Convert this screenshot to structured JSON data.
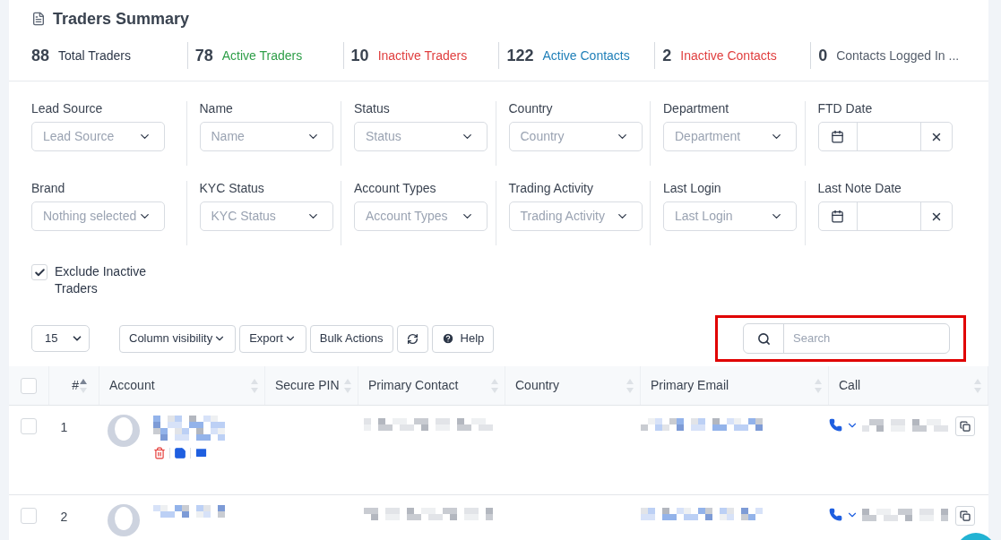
{
  "summary": {
    "title": "Traders Summary",
    "stats": [
      {
        "count": "88",
        "label": "Total Traders",
        "color": "#2d3748"
      },
      {
        "count": "78",
        "label": "Active Traders",
        "color": "#2e9e48"
      },
      {
        "count": "10",
        "label": "Inactive Traders",
        "color": "#e03e3e"
      },
      {
        "count": "122",
        "label": "Active Contacts",
        "color": "#1f7fb8"
      },
      {
        "count": "2",
        "label": "Inactive Contacts",
        "color": "#e03e3e"
      },
      {
        "count": "0",
        "label": "Contacts Logged In ...",
        "color": "#555e6b"
      }
    ]
  },
  "filters": [
    {
      "kind": "select",
      "label": "Lead Source",
      "placeholder": "Lead Source"
    },
    {
      "kind": "select",
      "label": "Name",
      "placeholder": "Name"
    },
    {
      "kind": "select",
      "label": "Status",
      "placeholder": "Status"
    },
    {
      "kind": "select",
      "label": "Country",
      "placeholder": "Country"
    },
    {
      "kind": "select",
      "label": "Department",
      "placeholder": "Department"
    },
    {
      "kind": "date",
      "label": "FTD Date"
    },
    {
      "kind": "select",
      "label": "Brand",
      "placeholder": "Nothing selected"
    },
    {
      "kind": "select",
      "label": "KYC Status",
      "placeholder": "KYC Status"
    },
    {
      "kind": "select",
      "label": "Account Types",
      "placeholder": "Account Types"
    },
    {
      "kind": "select",
      "label": "Trading Activity",
      "placeholder": "Trading Activity"
    },
    {
      "kind": "select",
      "label": "Last Login",
      "placeholder": "Last Login"
    },
    {
      "kind": "date",
      "label": "Last Note Date"
    }
  ],
  "exclude_inactive": {
    "label": "Exclude Inactive Traders",
    "checked": true
  },
  "toolbar": {
    "page_length": "15",
    "buttons": [
      {
        "kind": "dropdown",
        "label": "Column visibility"
      },
      {
        "kind": "dropdown",
        "label": "Export"
      },
      {
        "kind": "plain",
        "label": "Bulk Actions"
      },
      {
        "kind": "refresh"
      },
      {
        "kind": "help",
        "label": "Help"
      }
    ],
    "search": {
      "placeholder": "Search",
      "highlighted": true
    }
  },
  "table": {
    "select_all_checked": false,
    "columns": [
      {
        "label": "#",
        "sorted": true
      },
      {
        "label": "Account",
        "sorted": false
      },
      {
        "label": "Secure PIN",
        "sorted": false
      },
      {
        "label": "Primary Contact",
        "sorted": false
      },
      {
        "label": "Country",
        "sorted": false
      },
      {
        "label": "Primary Email",
        "sorted": false
      },
      {
        "label": "Call",
        "sorted": false
      }
    ],
    "rows": [
      {
        "index": "1",
        "checked": false,
        "actions": true
      },
      {
        "index": "2",
        "checked": false,
        "actions": false
      }
    ]
  }
}
